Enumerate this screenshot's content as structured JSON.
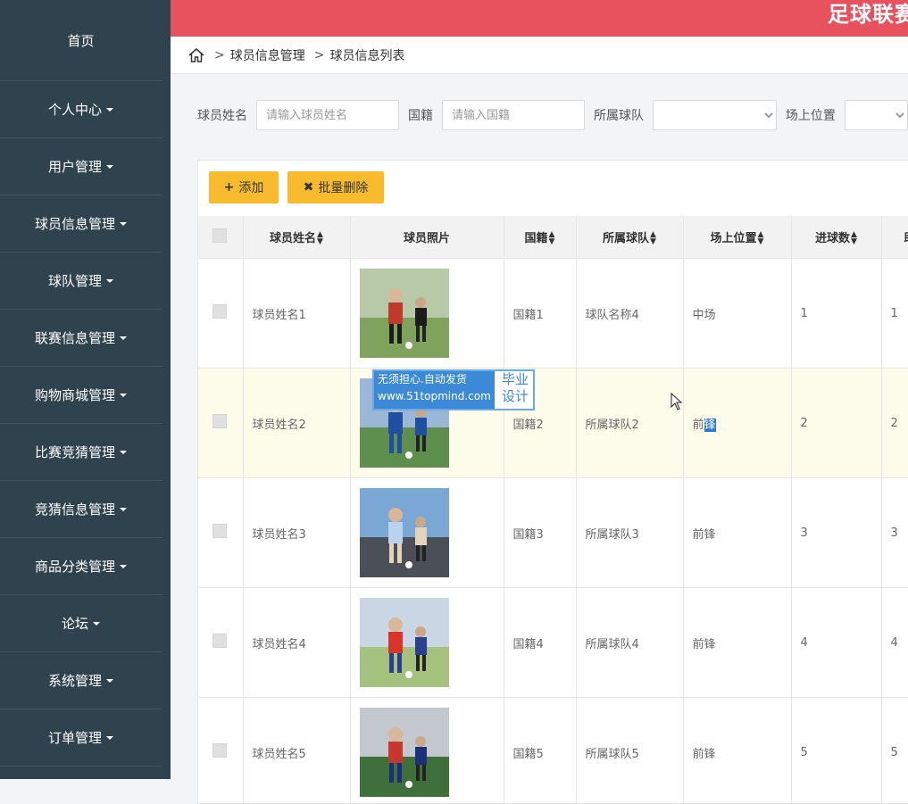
{
  "sidebar": {
    "items": [
      {
        "label": "首页",
        "dropdown": false
      },
      {
        "label": "个人中心",
        "dropdown": true
      },
      {
        "label": "用户管理",
        "dropdown": true
      },
      {
        "label": "球员信息管理",
        "dropdown": true
      },
      {
        "label": "球队管理",
        "dropdown": true
      },
      {
        "label": "联赛信息管理",
        "dropdown": true
      },
      {
        "label": "购物商城管理",
        "dropdown": true
      },
      {
        "label": "比赛竞猜管理",
        "dropdown": true
      },
      {
        "label": "竞猜信息管理",
        "dropdown": true
      },
      {
        "label": "商品分类管理",
        "dropdown": true
      },
      {
        "label": "论坛",
        "dropdown": true
      },
      {
        "label": "系统管理",
        "dropdown": true
      },
      {
        "label": "订单管理",
        "dropdown": true
      }
    ]
  },
  "header": {
    "title": "足球联赛",
    "accent": "#e8525f"
  },
  "breadcrumb": {
    "items": [
      "球员信息管理",
      "球员信息列表"
    ],
    "separator": ">"
  },
  "search": {
    "name_label": "球员姓名",
    "name_placeholder": "请输入球员姓名",
    "nationality_label": "国籍",
    "nationality_placeholder": "请输入国籍",
    "team_label": "所属球队",
    "team_value": "",
    "position_label": "场上位置",
    "position_value": ""
  },
  "toolbar": {
    "add_label": "添加",
    "add_icon": "+",
    "batch_delete_label": "批量删除",
    "batch_delete_icon": "✖"
  },
  "table": {
    "columns": [
      "球员姓名",
      "球员照片",
      "国籍",
      "所属球队",
      "场上位置",
      "进球数",
      "助"
    ],
    "rows": [
      {
        "name": "球员姓名1",
        "nationality": "国籍1",
        "team": "球队名称4",
        "position": "中场",
        "goals": "1",
        "assists": "1"
      },
      {
        "name": "球员姓名2",
        "nationality": "国籍2",
        "team": "所属球队2",
        "position": "前锋",
        "goals": "2",
        "assists": "2"
      },
      {
        "name": "球员姓名3",
        "nationality": "国籍3",
        "team": "所属球队3",
        "position": "前锋",
        "goals": "3",
        "assists": "3"
      },
      {
        "name": "球员姓名4",
        "nationality": "国籍4",
        "team": "所属球队4",
        "position": "前锋",
        "goals": "4",
        "assists": "4"
      },
      {
        "name": "球员姓名5",
        "nationality": "国籍5",
        "team": "所属球队5",
        "position": "前锋",
        "goals": "5",
        "assists": "5"
      }
    ]
  },
  "watermark": {
    "line1": "无须担心.自动发货",
    "line2": "www.51topmind.com",
    "side1": "毕业",
    "side2": "设计"
  },
  "colors": {
    "sidebar": "#2f434f",
    "button": "#f8bb2e",
    "highlight_row": "#fdfbea"
  }
}
